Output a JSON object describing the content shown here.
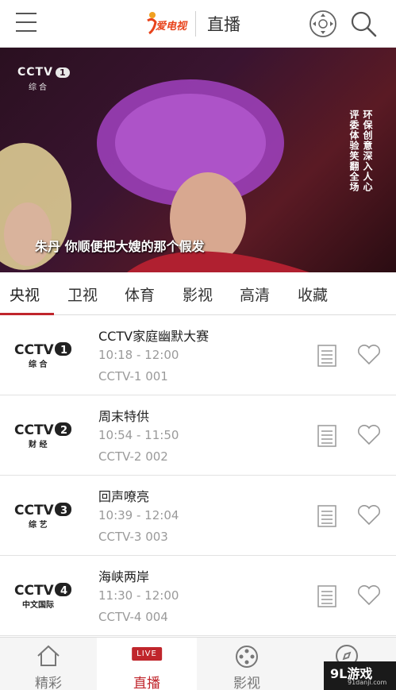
{
  "header": {
    "logo_text": "爱电视",
    "title": "直播",
    "menu_icon": "hamburger-icon",
    "joystick_icon": "joystick-icon",
    "search_icon": "search-icon"
  },
  "video": {
    "channel_bug": {
      "brand": "CCTV",
      "number": "1",
      "sub": "综合"
    },
    "vertical_caption": [
      "环保创意深入人心",
      "评委体验笑翻全场"
    ],
    "subtitle": "朱丹 你顺便把大嫂的那个假发"
  },
  "tabs": [
    {
      "label": "央视",
      "active": true
    },
    {
      "label": "卫视",
      "active": false
    },
    {
      "label": "体育",
      "active": false
    },
    {
      "label": "影视",
      "active": false
    },
    {
      "label": "高清",
      "active": false
    },
    {
      "label": "收藏",
      "active": false
    }
  ],
  "channels": [
    {
      "logo_brand": "CCTV",
      "logo_number": "1",
      "logo_sub": "综 合",
      "program": "CCTV家庭幽默大赛",
      "time": "10:18 - 12:00",
      "code": "CCTV-1 001"
    },
    {
      "logo_brand": "CCTV",
      "logo_number": "2",
      "logo_sub": "财 经",
      "program": "周末特供",
      "time": "10:54 - 11:50",
      "code": "CCTV-2 002"
    },
    {
      "logo_brand": "CCTV",
      "logo_number": "3",
      "logo_sub": "综 艺",
      "program": "回声嘹亮",
      "time": "10:39 - 12:04",
      "code": "CCTV-3 003"
    },
    {
      "logo_brand": "CCTV",
      "logo_number": "4",
      "logo_sub": "中文国际",
      "program": "海峡两岸",
      "time": "11:30 - 12:00",
      "code": "CCTV-4 004"
    }
  ],
  "bottom_nav": [
    {
      "label": "精彩",
      "icon": "home-icon",
      "active": false
    },
    {
      "label": "直播",
      "icon": "live-icon",
      "badge": "LIVE",
      "active": true
    },
    {
      "label": "影视",
      "icon": "film-reel-icon",
      "active": false
    },
    {
      "label": "",
      "icon": "compass-icon",
      "active": false
    }
  ],
  "watermark": {
    "main": "9L游戏",
    "sub": "91danji.com"
  },
  "colors": {
    "accent": "#c0262c",
    "logo_orange": "#e8431c",
    "muted_text": "#9a9a9a"
  }
}
